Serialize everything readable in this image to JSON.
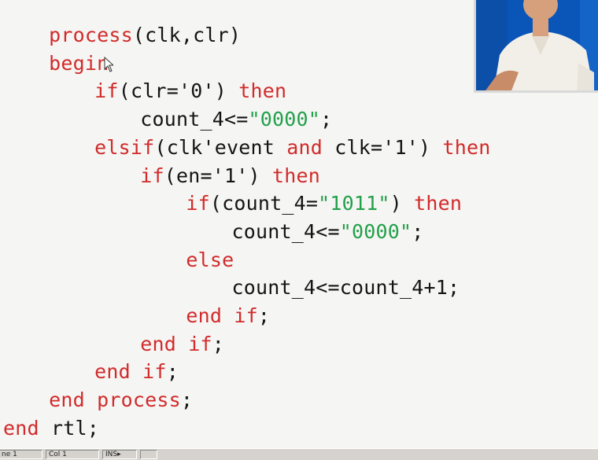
{
  "code": {
    "lines": [
      {
        "indent": 2,
        "tokens": [
          {
            "t": "process",
            "c": "kw"
          },
          {
            "t": "(clk,clr)",
            "c": "plain"
          }
        ]
      },
      {
        "indent": 2,
        "tokens": [
          {
            "t": "begin",
            "c": "kw"
          }
        ]
      },
      {
        "indent": 4,
        "tokens": [
          {
            "t": "if",
            "c": "kw"
          },
          {
            "t": "(clr='0') ",
            "c": "plain"
          },
          {
            "t": "then",
            "c": "kw"
          }
        ]
      },
      {
        "indent": 6,
        "tokens": [
          {
            "t": "count_4<=",
            "c": "plain"
          },
          {
            "t": "\"0000\"",
            "c": "str"
          },
          {
            "t": ";",
            "c": "plain"
          }
        ]
      },
      {
        "indent": 4,
        "tokens": [
          {
            "t": "elsif",
            "c": "kw"
          },
          {
            "t": "(clk'event ",
            "c": "plain"
          },
          {
            "t": "and",
            "c": "kw"
          },
          {
            "t": " clk='1') ",
            "c": "plain"
          },
          {
            "t": "then",
            "c": "kw"
          }
        ]
      },
      {
        "indent": 6,
        "tokens": [
          {
            "t": "if",
            "c": "kw"
          },
          {
            "t": "(en='1') ",
            "c": "plain"
          },
          {
            "t": "then",
            "c": "kw"
          }
        ]
      },
      {
        "indent": 8,
        "tokens": [
          {
            "t": "if",
            "c": "kw"
          },
          {
            "t": "(count_4=",
            "c": "plain"
          },
          {
            "t": "\"1011\"",
            "c": "str"
          },
          {
            "t": ") ",
            "c": "plain"
          },
          {
            "t": "then",
            "c": "kw"
          }
        ]
      },
      {
        "indent": 10,
        "tokens": [
          {
            "t": "count_4<=",
            "c": "plain"
          },
          {
            "t": "\"0000\"",
            "c": "str"
          },
          {
            "t": ";",
            "c": "plain"
          }
        ]
      },
      {
        "indent": 8,
        "tokens": [
          {
            "t": "else",
            "c": "kw"
          }
        ]
      },
      {
        "indent": 10,
        "tokens": [
          {
            "t": "count_4<=count_4+1;",
            "c": "plain"
          }
        ]
      },
      {
        "indent": 8,
        "tokens": [
          {
            "t": "end if",
            "c": "kw"
          },
          {
            "t": ";",
            "c": "plain"
          }
        ]
      },
      {
        "indent": 6,
        "tokens": [
          {
            "t": "end if",
            "c": "kw"
          },
          {
            "t": ";",
            "c": "plain"
          }
        ]
      },
      {
        "indent": 4,
        "tokens": [
          {
            "t": "end if",
            "c": "kw"
          },
          {
            "t": ";",
            "c": "plain"
          }
        ]
      },
      {
        "indent": 2,
        "tokens": [
          {
            "t": "end process",
            "c": "kw"
          },
          {
            "t": ";",
            "c": "plain"
          }
        ]
      },
      {
        "indent": 0,
        "tokens": [
          {
            "t": "end",
            "c": "kw"
          },
          {
            "t": " rtl;",
            "c": "plain"
          }
        ]
      }
    ]
  },
  "colors": {
    "keyword": "#d12b2b",
    "string": "#22a04a",
    "text": "#141414",
    "background": "#f5f5f3",
    "webcam_backdrop": "#0a56b8"
  },
  "webcam": {
    "icon": "presenter-video-feed"
  },
  "statusbar": {
    "line_label": "ne 1",
    "col_label": "Col 1",
    "mode_label": "INS",
    "mode_icon": "arrow-icon"
  }
}
